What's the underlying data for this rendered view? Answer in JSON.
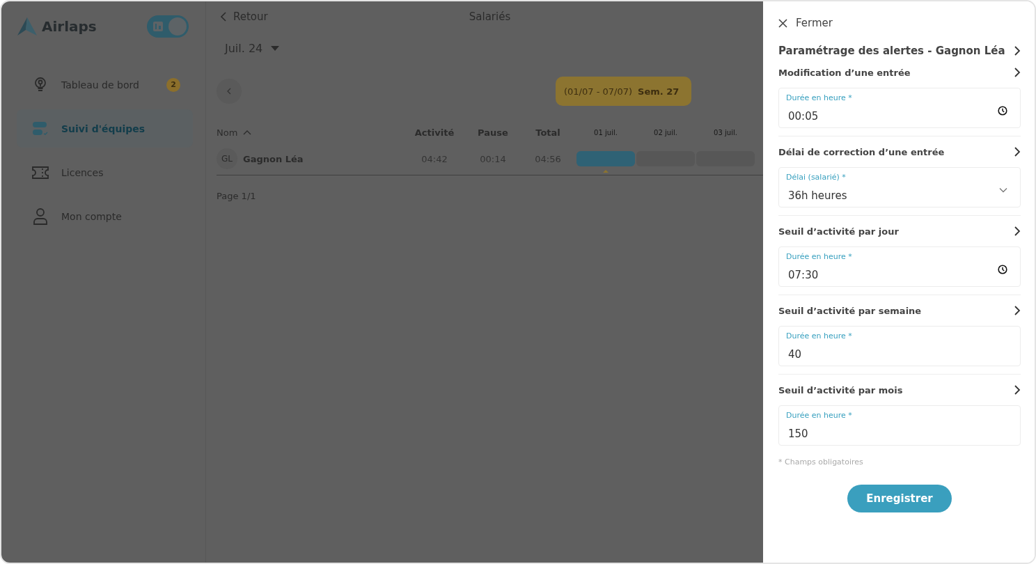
{
  "sidebar": {
    "brand": "Airlaps",
    "mode_switch": {
      "on": true
    },
    "items": [
      {
        "kind": "bulb",
        "label": "Tableau de bord",
        "badge": "2",
        "selected": false
      },
      {
        "kind": "teams",
        "label": "Suivi d'équipes",
        "selected": true
      },
      {
        "kind": "ticket",
        "label": "Licences",
        "selected": false
      },
      {
        "kind": "person",
        "label": "Mon compte",
        "selected": false
      }
    ]
  },
  "main": {
    "back": "Retour",
    "title": "Salariés",
    "month": "Juil. 24",
    "week": {
      "range": "(01/07 - 07/07)",
      "label": "Sem. 27"
    },
    "table": {
      "columns": [
        "Nom",
        "Activité",
        "Pause",
        "Total"
      ],
      "days": [
        {
          "label": "01 juil.",
          "selected": true
        },
        {
          "label": "02 juil.",
          "selected": false
        },
        {
          "label": "03 juil.",
          "selected": false
        }
      ],
      "rows": [
        {
          "initials": "GL",
          "name": "Gagnon Léa",
          "activity": "04:42",
          "pause": "00:14",
          "total": "04:56"
        }
      ]
    },
    "pagination": "Page 1/1"
  },
  "panel": {
    "close": "Fermer",
    "title": "Paramétrage des alertes - Gagnon Léa",
    "sections": [
      {
        "title": "Modification d’une entrée",
        "field": {
          "kind": "time",
          "label": "Durée en heure *",
          "value": "00:05"
        }
      },
      {
        "title": "Délai de correction d’une entrée",
        "field": {
          "kind": "select",
          "label": "Délai (salarié) *",
          "value": "36h heures"
        }
      },
      {
        "title": "Seuil d’activité par jour",
        "field": {
          "kind": "time",
          "label": "Durée en heure *",
          "value": "07:30"
        }
      },
      {
        "title": "Seuil d’activité par semaine",
        "field": {
          "kind": "number",
          "label": "Durée en heure *",
          "value": "40"
        }
      },
      {
        "title": "Seuil d’activité par mois",
        "field": {
          "kind": "number",
          "label": "Durée en heure *",
          "value": "150"
        }
      }
    ],
    "note": "* Champs obligatoires",
    "save": "Enregistrer"
  }
}
